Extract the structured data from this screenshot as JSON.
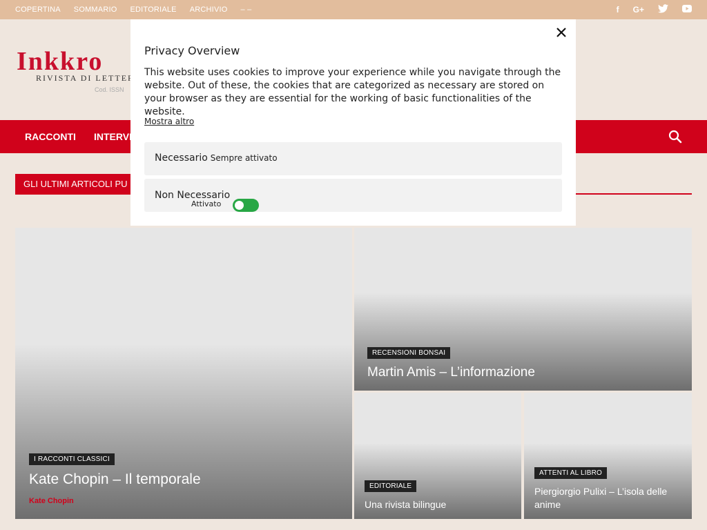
{
  "topbar": {
    "menu": [
      "COPERTINA",
      "SOMMARIO",
      "EDITORIALE",
      "ARCHIVIO",
      "– –"
    ],
    "social": [
      {
        "name": "facebook-icon",
        "glyph": "f"
      },
      {
        "name": "google-plus-icon",
        "glyph": "G+"
      },
      {
        "name": "twitter-icon",
        "glyph": "🐦"
      },
      {
        "name": "youtube-icon",
        "glyph": "▶"
      }
    ]
  },
  "header": {
    "logo_main": "Inkkro",
    "logo_sub": "RIVISTA DI LETTERA",
    "logo_issn": "Cod. ISSN"
  },
  "nav": {
    "items": [
      "RACCONTI",
      "INTERVI"
    ]
  },
  "section": {
    "title": "GLI ULTIMI ARTICOLI PU"
  },
  "tiles": [
    {
      "category": "I RACCONTI CLASSICI",
      "title": "Kate Chopin – Il temporale",
      "author": "Kate Chopin"
    },
    {
      "category": "RECENSIONI BONSAI",
      "title": "Martin Amis – L’informazione"
    },
    {
      "category": "EDITORIALE",
      "title": "Una rivista bilingue"
    },
    {
      "category": "ATTENTI AL LIBRO",
      "title": "Piergiorgio Pulixi – L’isola delle anime"
    }
  ],
  "modal": {
    "title": "Privacy Overview",
    "description": "This website uses cookies to improve your experience while you navigate through the website. Out of these, the cookies that are categorized as necessary are stored on your browser as they are essential for the working of basic functionalities of the website.",
    "more_link": "Mostra altro",
    "necessary_label": "Necessario",
    "necessary_badge": "Sempre attivato",
    "non_necessary_label": "Non Necessario",
    "non_necessary_state": "Attivato",
    "toggle_color": "#28a745"
  },
  "colors": {
    "brand_red": "#d0021b",
    "topbar": "#e2bd9d",
    "page_bg": "#efe6de"
  }
}
